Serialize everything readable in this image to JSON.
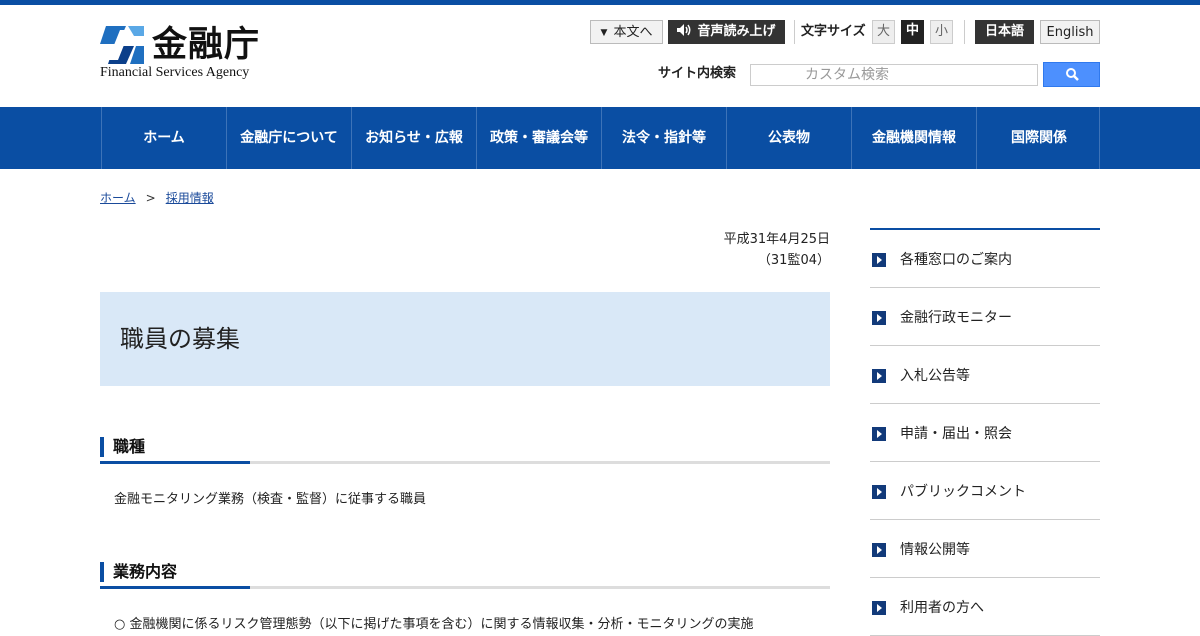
{
  "header": {
    "logo_name": "金融庁",
    "logo_en": "Financial Services Agency",
    "skip_label": "本文へ",
    "voice_label": "音声読み上げ",
    "font_size_label": "文字サイズ",
    "font_sizes": [
      "大",
      "中",
      "小"
    ],
    "lang_ja": "日本語",
    "lang_en": "English",
    "search_label": "サイト内検索",
    "search_placeholder": "カスタム検索"
  },
  "nav": {
    "items": [
      "ホーム",
      "金融庁について",
      "お知らせ・広報",
      "政策・審議会等",
      "法令・指針等",
      "公表物",
      "金融機関情報",
      "国際関係"
    ]
  },
  "breadcrumb": {
    "home": "ホーム",
    "separator": ">",
    "current": "採用情報"
  },
  "main": {
    "date": "平成31年4月25日",
    "doc_no": "（31監04）",
    "title": "職員の募集",
    "sections": [
      {
        "heading": "職種",
        "text": "金融モニタリング業務（検査・監督）に従事する職員"
      },
      {
        "heading": "業務内容",
        "text": "○ 金融機関に係るリスク管理態勢（以下に掲げた事項を含む）に関する情報収集・分析・モニタリングの実施"
      }
    ]
  },
  "sidebar": {
    "items": [
      "各種窓口のご案内",
      "金融行政モニター",
      "入札公告等",
      "申請・届出・照会",
      "パブリックコメント",
      "情報公開等",
      "利用者の方へ"
    ]
  },
  "colors": {
    "brand_blue": "#0a4ea3",
    "title_bg": "#d9e8f7",
    "search_button": "#4d90fe"
  }
}
